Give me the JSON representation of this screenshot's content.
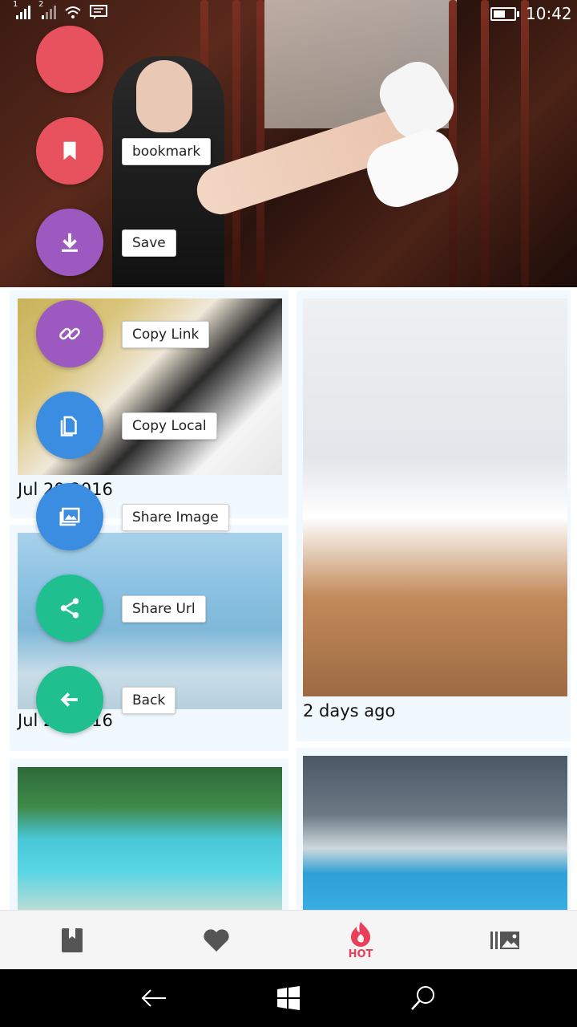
{
  "status_bar": {
    "signal1": "1",
    "signal2": "2",
    "time": "10:42"
  },
  "fab_menu": {
    "items": [
      {
        "key": "menu",
        "label": "",
        "color": "#e8525e"
      },
      {
        "key": "bookmark",
        "label": "bookmark",
        "color": "#e8525e",
        "icon": "bookmark-icon"
      },
      {
        "key": "save",
        "label": "Save",
        "color": "#9c59c0",
        "icon": "download-icon"
      },
      {
        "key": "copy_link",
        "label": "Copy Link",
        "color": "#9c59c0",
        "icon": "link-icon"
      },
      {
        "key": "copy_local",
        "label": "Copy Local",
        "color": "#3a8de0",
        "icon": "file-icon"
      },
      {
        "key": "share_image",
        "label": "Share Image",
        "color": "#3a8de0",
        "icon": "image-icon"
      },
      {
        "key": "share_url",
        "label": "Share Url",
        "color": "#1fbf8f",
        "icon": "share-icon"
      },
      {
        "key": "back",
        "label": "Back",
        "color": "#1fbf8f",
        "icon": "arrow-left-icon"
      }
    ]
  },
  "gallery": {
    "cards": [
      {
        "date": "Jul 20 2016"
      },
      {
        "date": "Jul 20 2016"
      },
      {
        "date": "2 days ago"
      }
    ]
  },
  "bottom_nav": {
    "tabs": [
      {
        "icon": "bookmark-icon",
        "label": ""
      },
      {
        "icon": "heart-icon",
        "label": ""
      },
      {
        "icon": "fire-icon",
        "label": "HOT",
        "active_color": "#e8405a"
      },
      {
        "icon": "library-icon",
        "label": ""
      }
    ]
  }
}
